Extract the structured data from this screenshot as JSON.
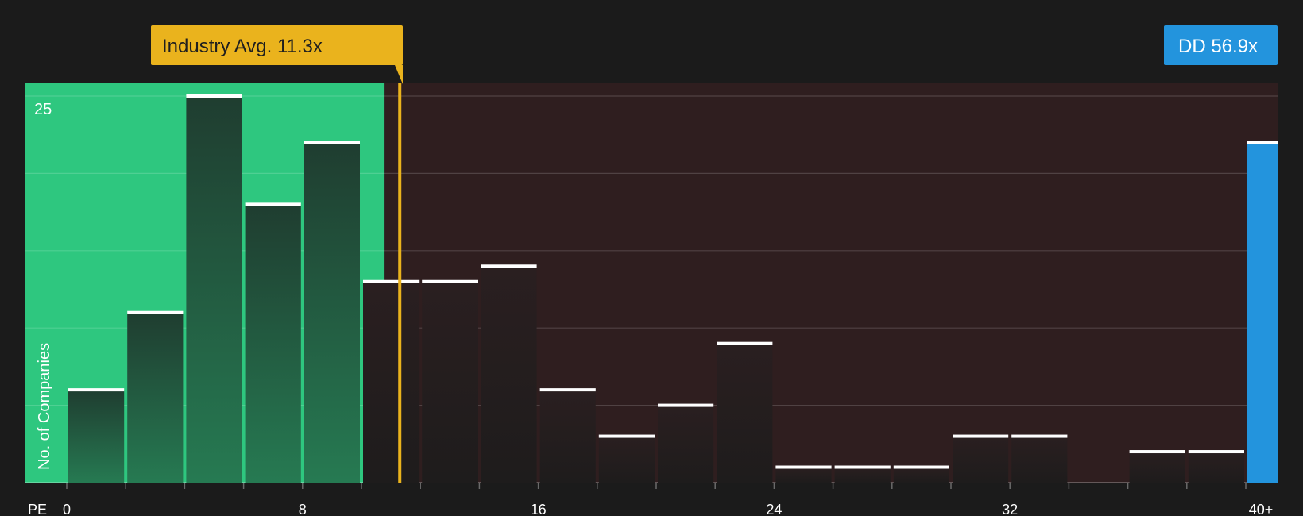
{
  "chart_data": {
    "type": "bar",
    "title": "",
    "xlabel": "PE",
    "ylabel": "No. of Companies",
    "x_ticks": [
      "0",
      "8",
      "16",
      "24",
      "32",
      "40+"
    ],
    "y_ticks": [
      "25"
    ],
    "ylim": [
      0,
      25
    ],
    "bin_width": 2,
    "bins_start": [
      0,
      2,
      4,
      6,
      8,
      10,
      12,
      14,
      16,
      18,
      20,
      22,
      24,
      26,
      28,
      30,
      32,
      34,
      36,
      38
    ],
    "values": [
      6,
      11,
      25,
      18,
      22,
      13,
      13,
      14,
      6,
      3,
      5,
      9,
      1,
      1,
      1,
      3,
      3,
      0,
      2,
      2
    ],
    "industry_avg": {
      "label": "Industry Avg. 11.3x",
      "value": 11.3
    },
    "company": {
      "label": "DD 56.9x",
      "value": 56.9,
      "bar_height": 22
    },
    "grid": true,
    "colors": {
      "undervalued_zone": "#2ec77f",
      "overvalued_zone": "#2f1e1f",
      "industry_marker": "#eab31d",
      "company_bar": "#2394dd",
      "bar_top": "#ffffff"
    }
  }
}
